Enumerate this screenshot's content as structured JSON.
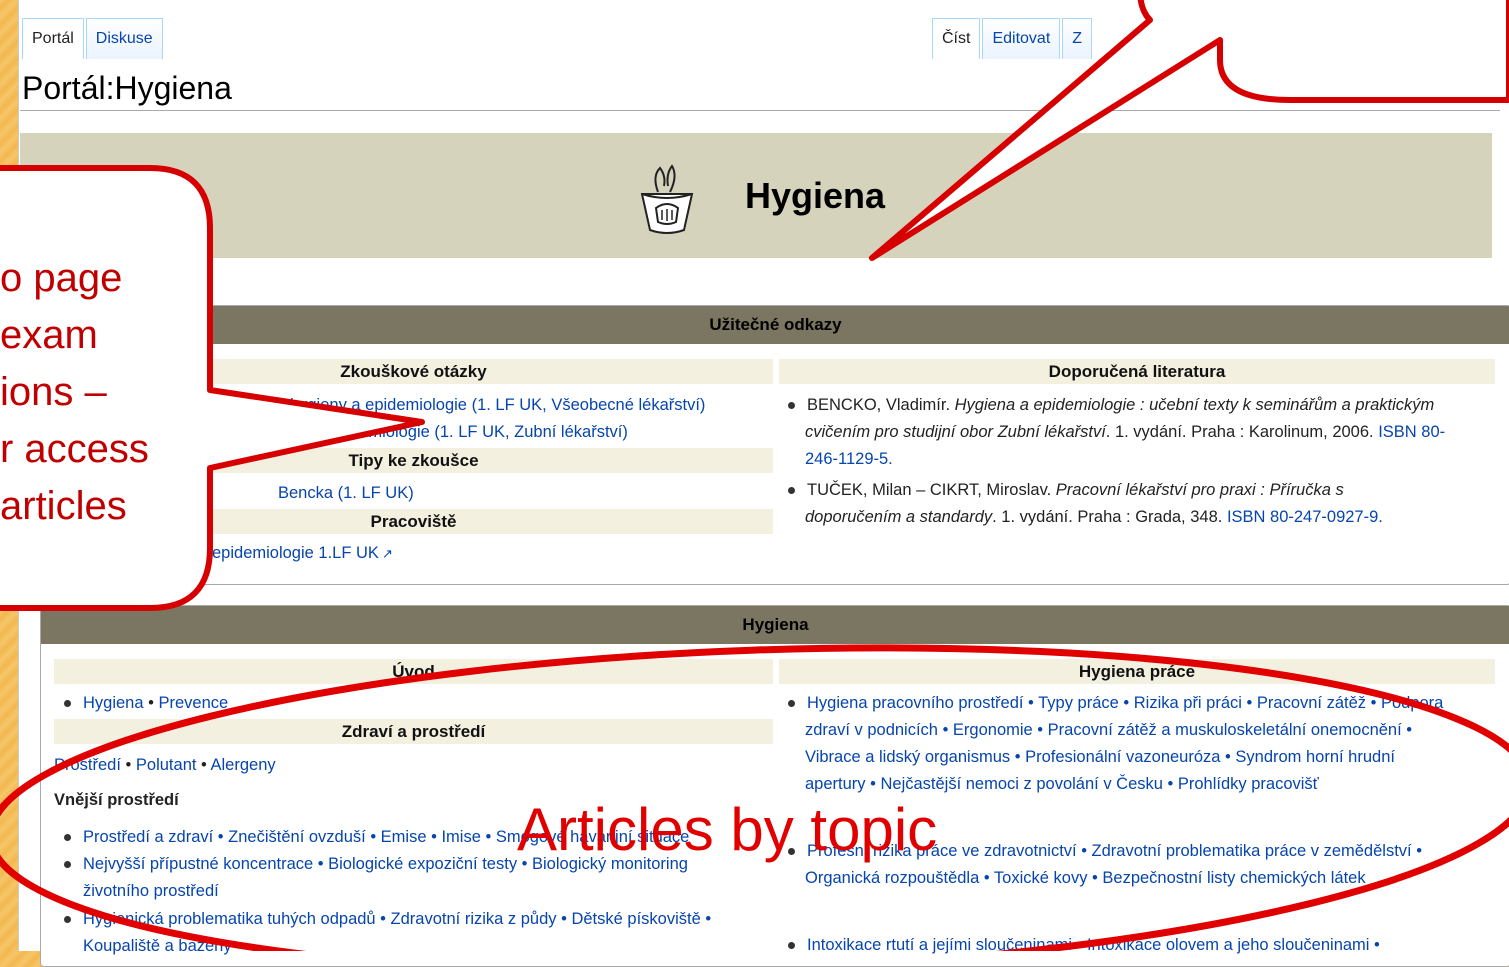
{
  "tabs_left": [
    "Portál",
    "Diskuse"
  ],
  "tabs_right": [
    "Číst",
    "Editovat",
    "Z"
  ],
  "page_title": "Portál:Hygiena",
  "banner_title": "Hygiena",
  "useful": {
    "title": "Užitečné odkazy",
    "exam_title": "Zkouškové otázky",
    "exam_1": "zkoušce z hygieny a epidemiologie (1. LF UK, Všeobecné lékařství)",
    "exam_2": "demiologie (1. LF UK, Zubní lékařství)",
    "tips_title": "Tipy ke zkoušce",
    "tips_1": "Bencka (1. LF UK)",
    "work_title": "Pracoviště",
    "work_1": "epidemiologie 1.LF UK",
    "lit_title": "Doporučená literatura",
    "lit_1a": "BENCKO, Vladimír. ",
    "lit_1b": "Hygiena a epidemiologie :  učební texty k seminářům a praktickým",
    "lit_1c": "cvičením pro studijní obor Zubní lékařství",
    "lit_1d": ". 1. vydání. Praha : Karolinum, 2006. ",
    "lit_1e": "ISBN 80-",
    "lit_1f": "246-1129-5.",
    "lit_2a": "TUČEK, Milan – CIKRT, Miroslav. ",
    "lit_2b": "Pracovní lékařství pro praxi :  Příručka s",
    "lit_2c": "doporučením a standardy",
    "lit_2d": ". 1. vydání. Praha : Grada, 348. ",
    "lit_2e": "ISBN 80-247-0927-9."
  },
  "hygiena": {
    "title": "Hygiena",
    "uvod_title": "Úvod",
    "uvod_links": [
      "Hygiena",
      "Prevence"
    ],
    "zdravi_title": "Zdraví a prostředí",
    "zdravi_links": [
      "Prostředí",
      "Polutant",
      "Alergeny"
    ],
    "vnejsi_title": "Vnější prostředí",
    "vn_row1": "Prostředí a zdraví • Znečištění ovzduší • Emise • Imise • Smogové havarijní situace",
    "vn_row2a": "Nejvyšší přípustné koncentrace • Biologické expoziční testy • Biologický monitoring",
    "vn_row2b": "životního prostředí",
    "vn_row3a": "Hygienická problematika tuhých odpadů • Zdravotní rizika z půdy • Dětské pískoviště •",
    "vn_row3b": "Koupaliště a bazény",
    "prace_title": "Hygiena práce",
    "pr_row1a": "Hygiena pracovního prostředí • Typy práce • Rizika při práci • Pracovní zátěž • Podpora",
    "pr_row1b": "zdraví v podnicích • Ergonomie • Pracovní zátěž a muskuloskeletální onemocnění •",
    "pr_row1c": "Vibrace a lidský organismus • Profesionální vazoneuróza • Syndrom horní hrudní",
    "pr_row1d": "apertury • Nejčastější nemoci z povolání v Česku • Prohlídky pracovišť",
    "pr_row2a": "Profesní rizika práce ve zdravotnictví • Zdravotní problematika práce v zemědělství •",
    "pr_row2b": "Organická rozpouštědla • Toxické kovy • Bezpečnostní listy chemických látek",
    "pr_row3": "Intoxikace rtutí a jejími sloučeninami • Intoxikace olovem a jeho sloučeninami •"
  },
  "callout_left": [
    "o page",
    "exam",
    "ions –",
    "r access",
    "articles"
  ],
  "articles_label": "Articles by topic",
  "colors": {
    "callout_red": "#e00000",
    "banner": "#d6d3bd",
    "box_header": "#7b7662",
    "link": "#0645ad"
  }
}
